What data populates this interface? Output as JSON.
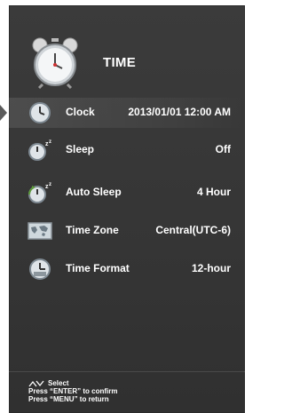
{
  "header": {
    "title": "TIME",
    "icon": "alarm-clock-icon"
  },
  "menu": {
    "items": [
      {
        "label": "Clock",
        "value": "2013/01/01 12:00 AM",
        "icon": "clock-icon",
        "selected": true
      },
      {
        "label": "Sleep",
        "value": "Off",
        "icon": "sleep-timer-icon",
        "selected": false
      },
      {
        "label": "Auto Sleep",
        "value": "4 Hour",
        "icon": "auto-sleep-icon",
        "selected": false
      },
      {
        "label": "Time Zone",
        "value": "Central(UTC-6)",
        "icon": "world-map-icon",
        "selected": false
      },
      {
        "label": "Time Format",
        "value": "12-hour",
        "icon": "time-format-icon",
        "selected": false
      }
    ]
  },
  "help": {
    "select": "Select",
    "confirm": "Press “ENTER” to confirm",
    "return": "Press “MENU” to return"
  },
  "colors": {
    "panel": "#383838",
    "text": "#ffffff",
    "icon_face": "#e9edf0",
    "icon_ring": "#7f8a93"
  }
}
